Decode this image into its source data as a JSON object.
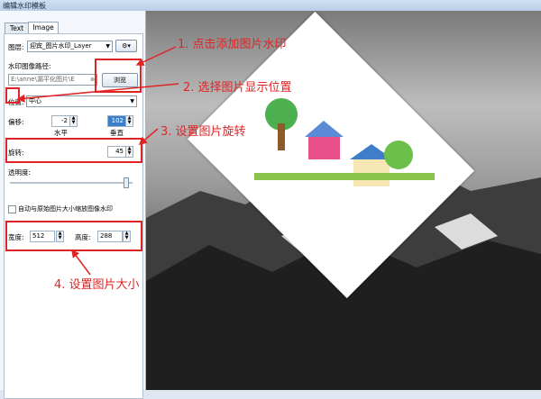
{
  "window": {
    "title": "编辑水印模板"
  },
  "tabs": [
    {
      "label": "Text"
    },
    {
      "label": "Image"
    }
  ],
  "image_panel": {
    "layer_label": "图层:",
    "layer_value": "迎宾_图片水印_Layer",
    "path_label": "水印图像路径:",
    "path_value": "E:\\anne\\漏平化图片\\E",
    "browse_label": "浏览",
    "position_label": "位置:",
    "position_value": "中心",
    "offset_label": "偏移:",
    "offset_x": "-2",
    "offset_y": "102",
    "horizontal_label": "水平",
    "vertical_label": "垂直",
    "rotation_label": "旋转:",
    "rotation_value": "45",
    "opacity_label": "透明度:",
    "opacity_value": 0.95,
    "auto_scale_label": "自动与原始图片大小缩放图像水印",
    "width_label": "宽度:",
    "width_value": "512",
    "height_label": "高度:",
    "height_value": "288"
  },
  "annotations": {
    "step1": "1. 点击添加图片水印",
    "step2": "2. 选择图片显示位置",
    "step3": "3. 设置图片旋转",
    "step4": "4. 设置图片大小"
  },
  "colors": {
    "annotation": "#e02424",
    "accent": "#3c7fc9"
  }
}
